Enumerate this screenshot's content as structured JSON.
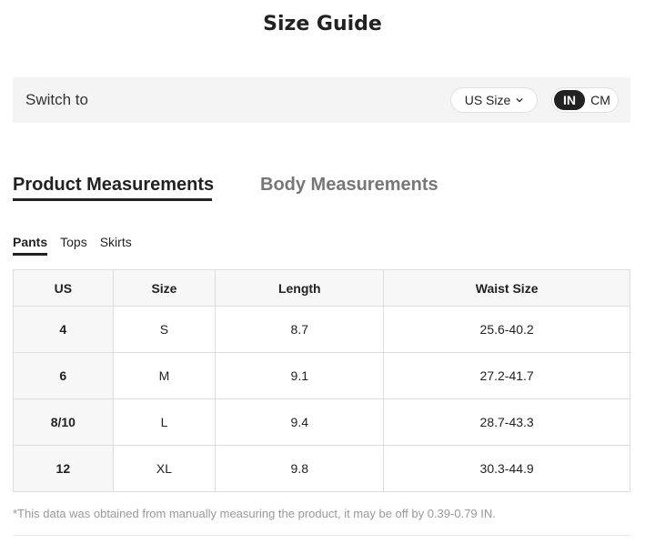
{
  "title": "Size Guide",
  "switch": {
    "label": "Switch to",
    "size_select": "US Size",
    "units": [
      "IN",
      "CM"
    ],
    "active_unit": "IN"
  },
  "tabs": {
    "product": "Product Measurements",
    "body": "Body Measurements"
  },
  "subtabs": [
    "Pants",
    "Tops",
    "Skirts"
  ],
  "table": {
    "headers": [
      "US",
      "Size",
      "Length",
      "Waist Size"
    ],
    "rows": [
      [
        "4",
        "S",
        "8.7",
        "25.6-40.2"
      ],
      [
        "6",
        "M",
        "9.1",
        "27.2-41.7"
      ],
      [
        "8/10",
        "L",
        "9.4",
        "28.7-43.3"
      ],
      [
        "12",
        "XL",
        "9.8",
        "30.3-44.9"
      ]
    ]
  },
  "note": "*This data was obtained from manually measuring the product, it may be off by 0.39-0.79 IN."
}
